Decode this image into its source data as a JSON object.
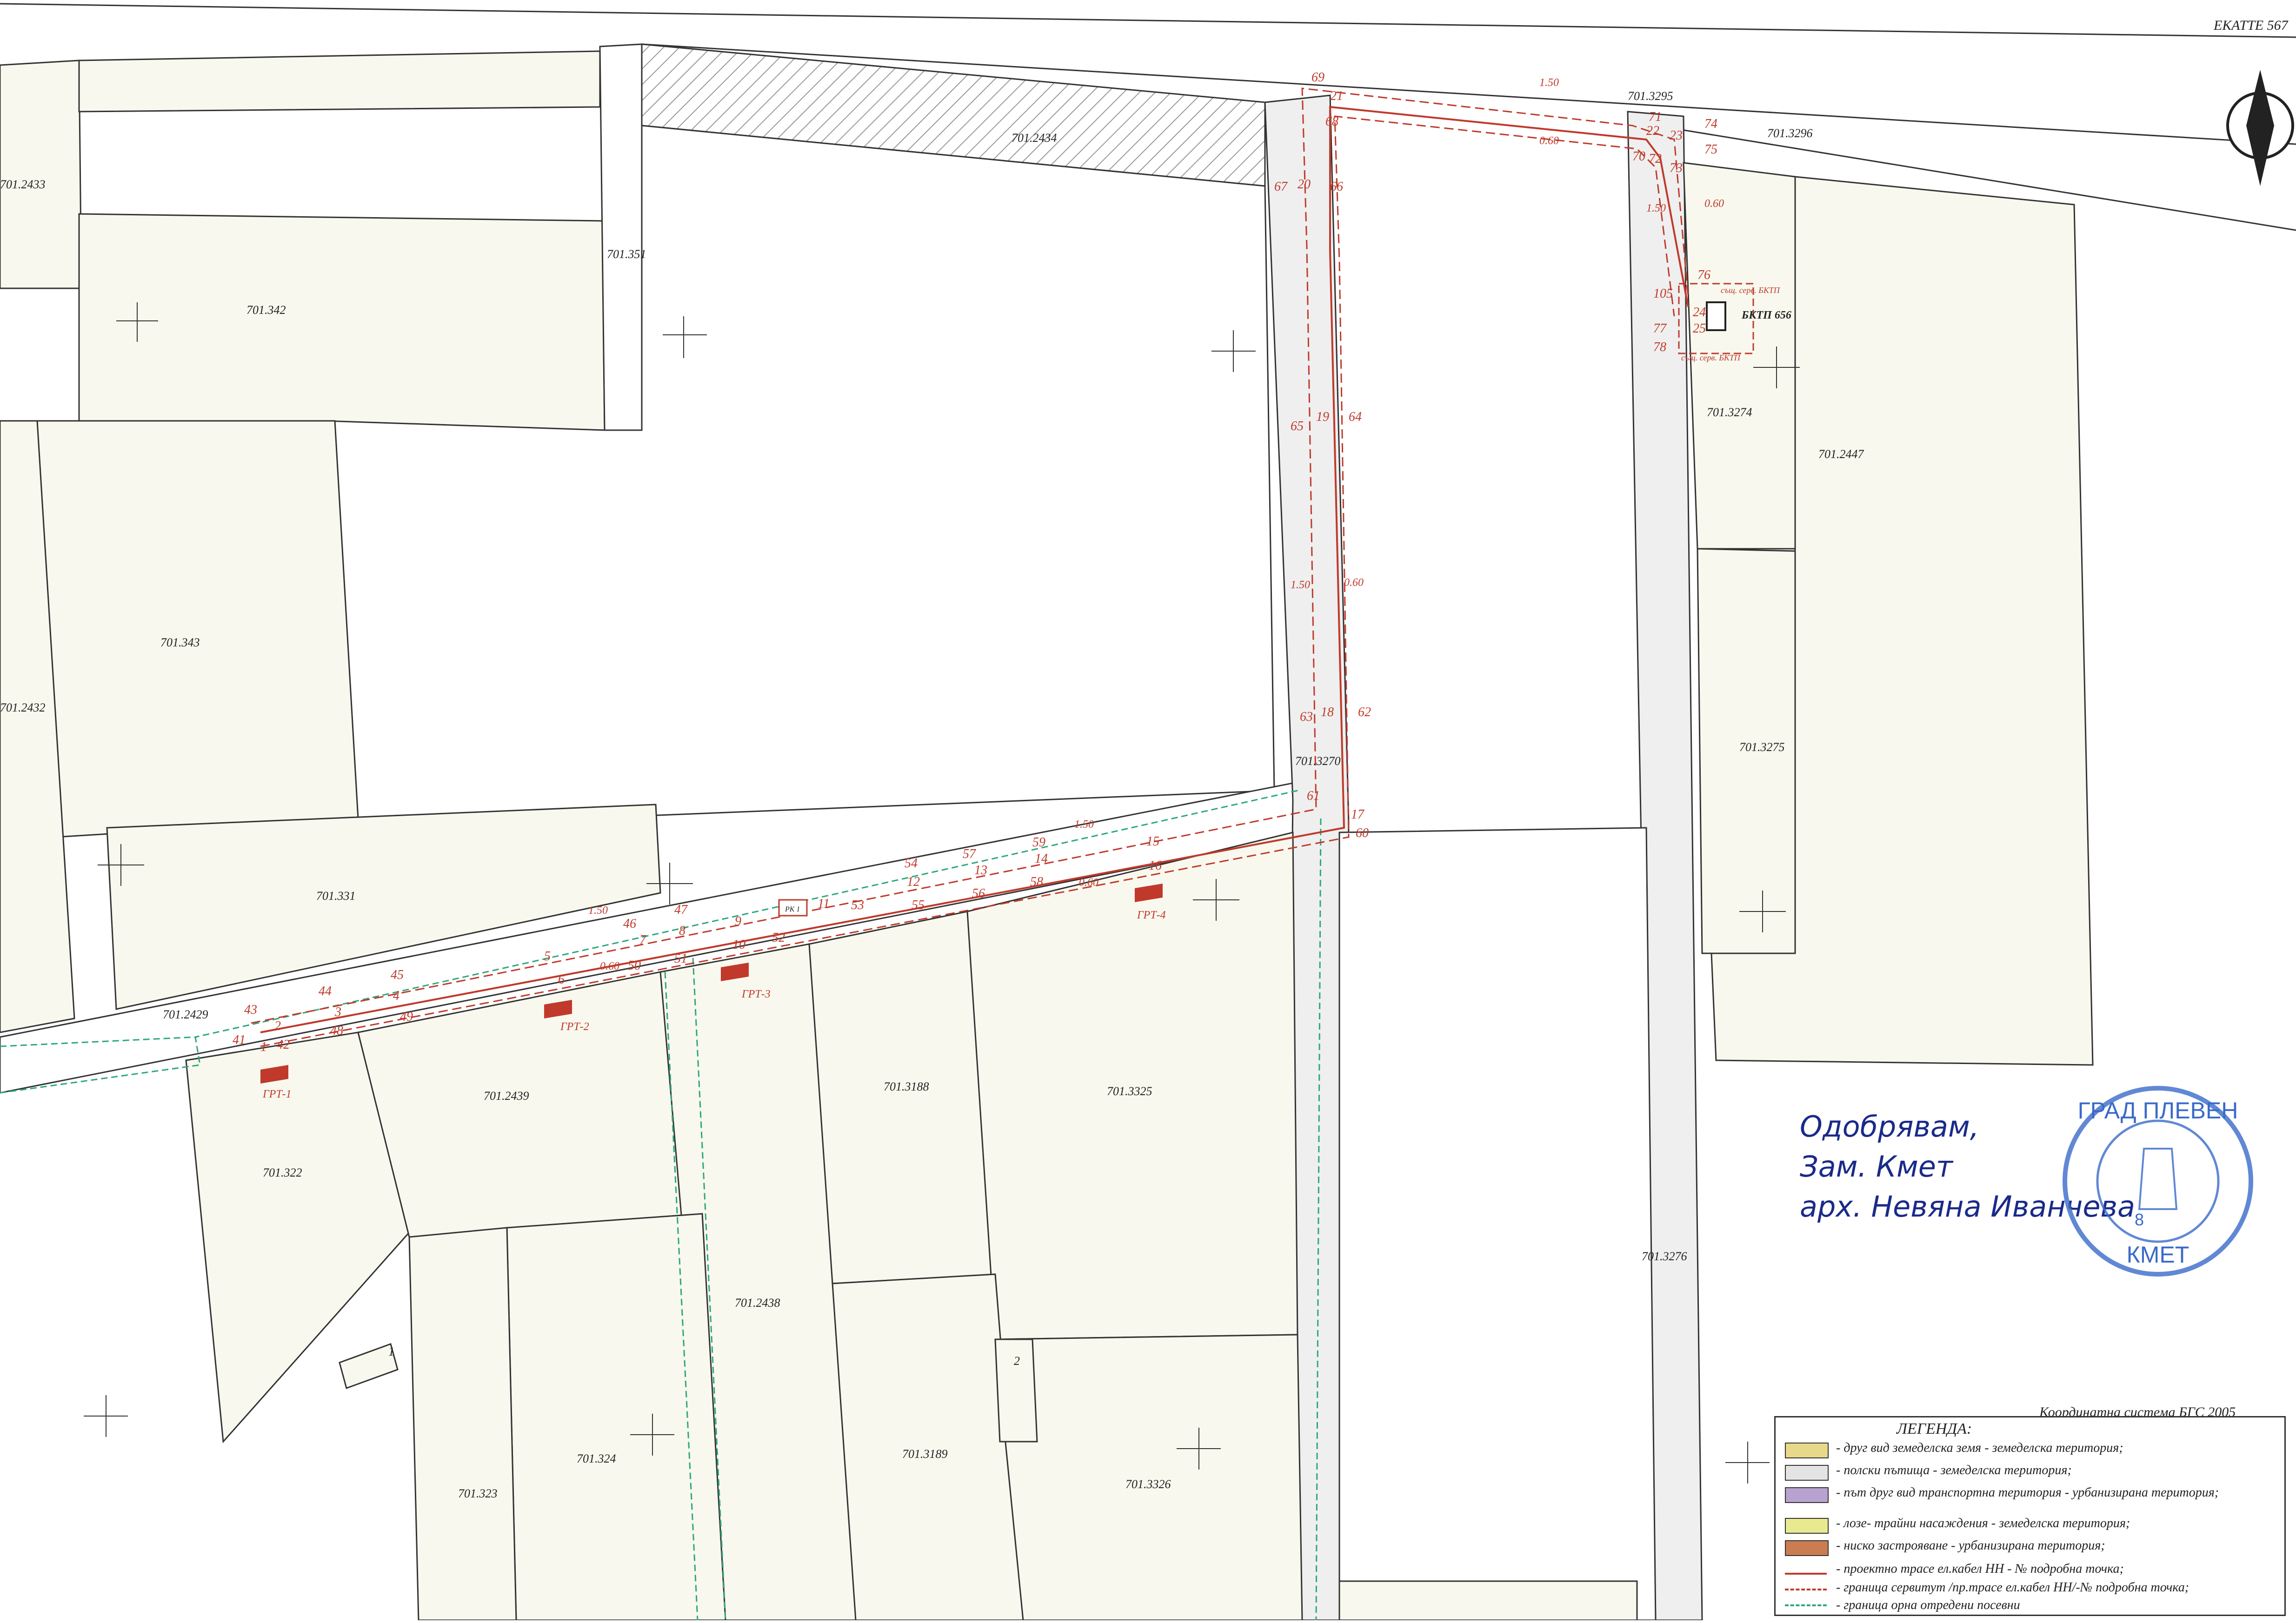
{
  "header": {
    "ekatte": "ЕКАТТЕ 567"
  },
  "coordinate_system": "Координатна система БГС 2005",
  "parcels": [
    {
      "id": "p2433",
      "label": "701.2433"
    },
    {
      "id": "p351",
      "label": "701.351"
    },
    {
      "id": "p342",
      "label": "701.342"
    },
    {
      "id": "p2434",
      "label": "701.2434"
    },
    {
      "id": "p3295",
      "label": "701.3295"
    },
    {
      "id": "p3296",
      "label": "701.3296"
    },
    {
      "id": "p343",
      "label": "701.343"
    },
    {
      "id": "p2432",
      "label": "701.2432"
    },
    {
      "id": "p3270",
      "label": "701.3270"
    },
    {
      "id": "p3274",
      "label": "701.3274"
    },
    {
      "id": "p2447",
      "label": "701.2447"
    },
    {
      "id": "p3275",
      "label": "701.3275"
    },
    {
      "id": "p331",
      "label": "701.331"
    },
    {
      "id": "p2429",
      "label": "701.2429"
    },
    {
      "id": "p2439",
      "label": "701.2439"
    },
    {
      "id": "p3188",
      "label": "701.3188"
    },
    {
      "id": "p3325",
      "label": "701.3325"
    },
    {
      "id": "p322",
      "label": "701.322"
    },
    {
      "id": "p2438",
      "label": "701.2438"
    },
    {
      "id": "p3276",
      "label": "701.3276"
    },
    {
      "id": "p324",
      "label": "701.324"
    },
    {
      "id": "p3189",
      "label": "701.3189"
    },
    {
      "id": "p3326",
      "label": "701.3326"
    },
    {
      "id": "p323",
      "label": "701.323"
    }
  ],
  "small_labels": {
    "one": "1",
    "two": "2"
  },
  "structures": {
    "bktp": "БКТП 656",
    "serv_top": "същ. серв. БКТП",
    "serv_bottom": "същ. серв. БКТП",
    "rk": "РК 1",
    "grt1": "ГРТ-1",
    "grt2": "ГРТ-2",
    "grt3": "ГРТ-3",
    "grt4": "ГРТ-4"
  },
  "dimensions": {
    "d150": "1.50",
    "d060": "0.60"
  },
  "points": [
    "1",
    "2",
    "3",
    "4",
    "5",
    "6",
    "7",
    "8",
    "9",
    "10",
    "11",
    "12",
    "13",
    "14",
    "15",
    "16",
    "17",
    "18",
    "19",
    "20",
    "21",
    "22",
    "23",
    "24",
    "25",
    "41",
    "42",
    "43",
    "44",
    "45",
    "46",
    "47",
    "48",
    "49",
    "50",
    "51",
    "52",
    "53",
    "54",
    "55",
    "56",
    "57",
    "58",
    "59",
    "60",
    "61",
    "62",
    "63",
    "64",
    "65",
    "66",
    "67",
    "68",
    "69",
    "70",
    "71",
    "72",
    "73",
    "74",
    "75",
    "76",
    "77",
    "78",
    "105"
  ],
  "approval": {
    "line1": "Одобрявам,",
    "line2": "Зам. Кмет",
    "line3": "арх. Невяна Иванчева"
  },
  "stamp": {
    "top": "ГРАД ПЛЕВЕН",
    "bottom": "КМЕТ",
    "number": "8"
  },
  "legend": {
    "title": "ЛЕГЕНДА:",
    "items": [
      {
        "color": "#e8d98a",
        "text": "- друг вид земеделска земя - земеделска територия;"
      },
      {
        "color": "#e4e4e4",
        "text": "- полски пътища - земеделска територия;"
      },
      {
        "color": "#b8a2cf",
        "text": "- път друг вид транспортна територия - урбанизирана територия;"
      },
      {
        "color": "#e9ea8f",
        "text": "- лозе- трайни насаждения - земеделска територия;"
      },
      {
        "color": "#c97d50",
        "text": "- ниско застрояване - урбанизирана територия;"
      },
      {
        "color": "#ffffff",
        "text": "- проектно трасе ел.кабел НН - № подробна точка;"
      },
      {
        "color": "#ffffff",
        "text": "- граница сервитут /пр.трасе ел.кабел НН/-№ подробна точка;"
      },
      {
        "color": "#ffffff",
        "text": "- граница орна отредени посевни"
      }
    ]
  }
}
